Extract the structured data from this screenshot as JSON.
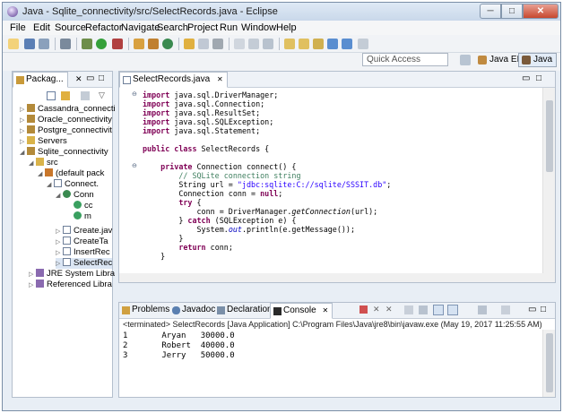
{
  "window": {
    "title": "Java - Sqlite_connectivity/src/SelectRecords.java - Eclipse",
    "min_glyph": "─",
    "max_glyph": "□",
    "close_glyph": "✕"
  },
  "menu": [
    "File",
    "Edit",
    "Source",
    "Refactor",
    "Navigate",
    "Search",
    "Project",
    "Run",
    "Window",
    "Help"
  ],
  "quick_access": {
    "placeholder": "Quick Access"
  },
  "perspectives": {
    "java_ee": "Java EE",
    "java": "Java"
  },
  "package_explorer": {
    "tab_label": "Packag...",
    "tree": [
      "Cassandra_connecti",
      "Oracle_connectivity",
      "Postgre_connectivit",
      "Servers",
      "Sqlite_connectivity",
      "src",
      "(default pack",
      "Connect.",
      "Conn",
      "cc",
      "m",
      "Create.jav",
      "CreateTa",
      "InsertRec",
      "SelectRec",
      "JRE System Libra",
      "Referenced Libra"
    ]
  },
  "editor": {
    "tab_label": "SelectRecords.java"
  },
  "console": {
    "tabs": {
      "problems": "Problems",
      "javadoc": "Javadoc",
      "declaration": "Declaration",
      "console": "Console"
    },
    "header": "<terminated> SelectRecords [Java Application] C:\\Program Files\\Java\\jre8\\bin\\javaw.exe (May 19, 2017 11:25:55 AM)",
    "lines": [
      "1       Aryan   30000.0",
      "2       Robert  40000.0",
      "3       Jerry   50000.0"
    ]
  },
  "colors": {
    "keyword": "#7f0055",
    "comment": "#3f7f5f",
    "string": "#2a00ff",
    "static_field": "#0000c0"
  }
}
